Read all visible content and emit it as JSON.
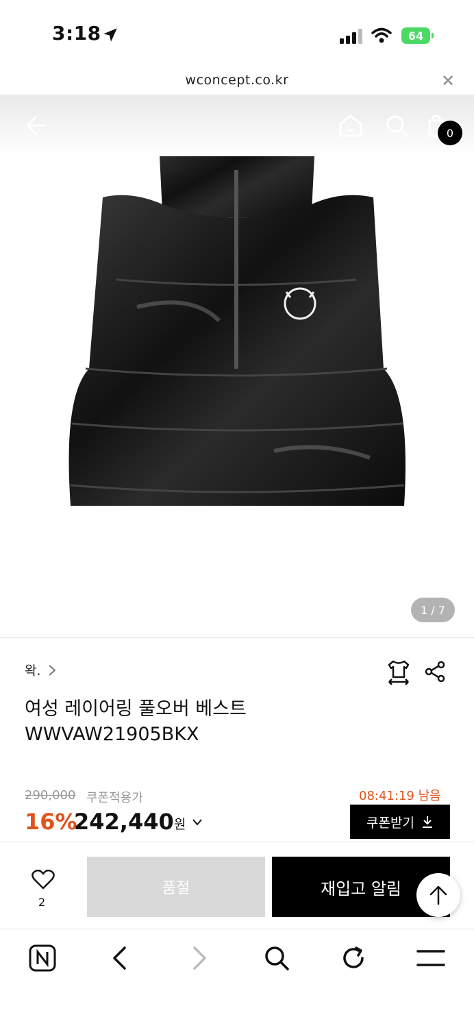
{
  "status_bar": {
    "time": "3:18",
    "battery": "64"
  },
  "browser": {
    "url": "wconcept.co.kr"
  },
  "header": {
    "cart_count": "0"
  },
  "gallery": {
    "counter": "1 / 7"
  },
  "product": {
    "brand": "왁.",
    "title_line1": "여성 레이어링 풀오버 베스트",
    "title_line2": "WWVAW21905BKX",
    "original_price": "290,000",
    "coupon_price_label": "쿠폰적용가",
    "countdown": "08:41:19 남음",
    "discount": "16%",
    "price": "242,440",
    "currency": "원",
    "coupon_button": "쿠폰받기"
  },
  "actions": {
    "wish_count": "2",
    "soldout_label": "품절",
    "restock_label": "재입고 알림"
  },
  "colors": {
    "accent": "#e0531c",
    "black": "#000000",
    "disabled": "#d9d9d9"
  },
  "icons": [
    "location-arrow-icon",
    "signal-icon",
    "wifi-icon",
    "close-icon",
    "back-arrow-icon",
    "home-icon",
    "search-icon",
    "cart-icon",
    "chevron-right-icon",
    "size-guide-icon",
    "share-icon",
    "chevron-down-icon",
    "download-icon",
    "heart-icon",
    "arrow-up-icon",
    "naver-icon",
    "browser-back-icon",
    "browser-forward-icon",
    "browser-search-icon",
    "refresh-icon",
    "menu-icon"
  ]
}
